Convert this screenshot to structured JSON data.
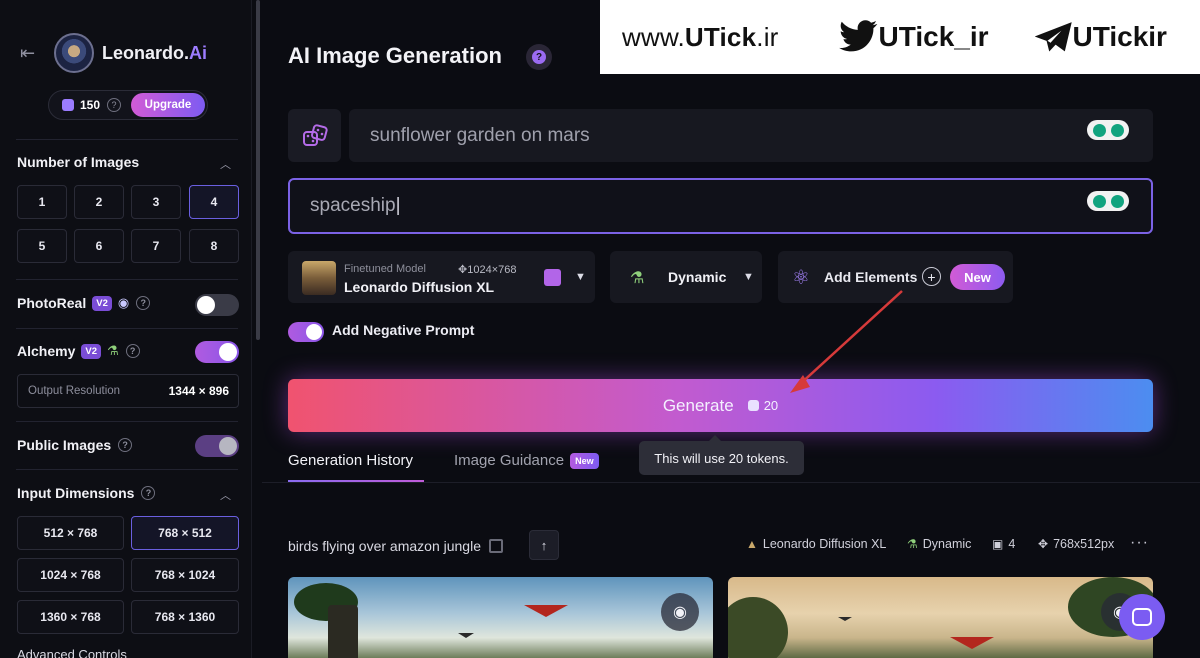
{
  "watermark": {
    "site_prefix": "www.",
    "site_bold": "UTick",
    "site_suffix": ".ir",
    "twitter_handle": "UTick_ir",
    "telegram_handle": "UTickir"
  },
  "sidebar": {
    "brand_name": "Leonardo.",
    "brand_suffix": "Ai",
    "tokens": "150",
    "upgrade_label": "Upgrade",
    "number_of_images": {
      "title": "Number of Images",
      "options": [
        "1",
        "2",
        "3",
        "4",
        "5",
        "6",
        "7",
        "8"
      ],
      "selected": "4"
    },
    "photoreal": {
      "label": "PhotoReal",
      "badge": "V2",
      "enabled": false
    },
    "alchemy": {
      "label": "Alchemy",
      "badge": "V2",
      "enabled": true
    },
    "output_resolution": {
      "label": "Output Resolution",
      "value": "1344 × 896"
    },
    "public_images": {
      "label": "Public Images",
      "enabled": true
    },
    "input_dimensions": {
      "title": "Input Dimensions",
      "options": [
        "512 × 768",
        "768 × 512",
        "1024 × 768",
        "768 × 1024",
        "1360 × 768",
        "768 × 1360"
      ],
      "selected": "768 × 512"
    },
    "advanced_controls": "Advanced Controls"
  },
  "main": {
    "title": "AI Image Generation",
    "help_glyph": "?",
    "prompt": "sunflower garden on mars",
    "negative_prompt": "spaceship",
    "model": {
      "subtitle": "Finetuned Model",
      "dimensions": "1024×768",
      "name": "Leonardo Diffusion XL"
    },
    "style": "Dynamic",
    "add_elements_label": "Add Elements",
    "new_label": "New",
    "negative_prompt_toggle_label": "Add Negative Prompt",
    "negative_prompt_enabled": true,
    "generate_label": "Generate",
    "generate_cost": "20",
    "tooltip": "This will use 20 tokens.",
    "tabs": [
      {
        "label": "Generation History",
        "active": true
      },
      {
        "label": "Image Guidance",
        "badge": "New",
        "active": false
      }
    ],
    "history": {
      "prompt": "birds flying over amazon jungle",
      "model": "Leonardo Diffusion XL",
      "style": "Dynamic",
      "count": "4",
      "size": "768x512px"
    }
  },
  "colors": {
    "accent_purple": "#8b5bf0",
    "accent_pink": "#d25bd6",
    "generate_start": "#f0536f",
    "generate_end": "#4c8df0",
    "arrow_red": "#d63a3a"
  }
}
